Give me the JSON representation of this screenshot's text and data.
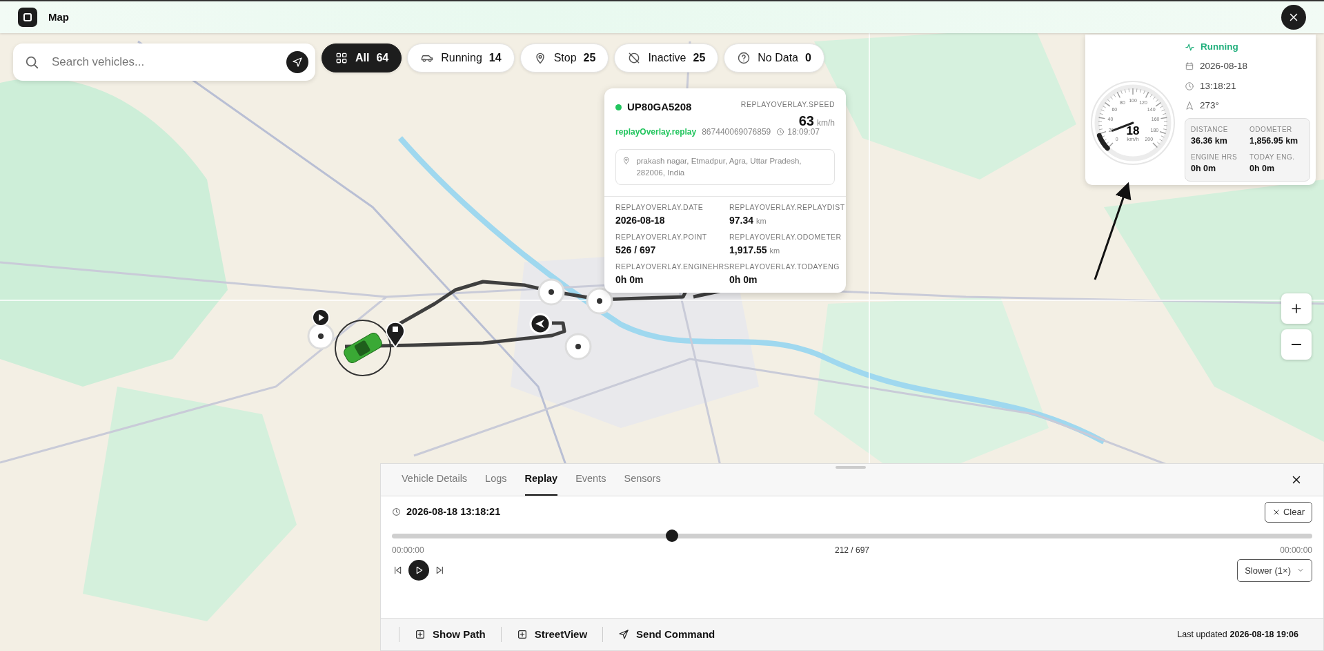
{
  "header": {
    "title": "Map"
  },
  "search": {
    "placeholder": "Search vehicles..."
  },
  "filters": [
    {
      "kind": "grid",
      "label": "All",
      "count": "64",
      "selected": true
    },
    {
      "kind": "car",
      "label": "Running",
      "count": "14",
      "selected": false
    },
    {
      "kind": "pin",
      "label": "Stop",
      "count": "25",
      "selected": false
    },
    {
      "kind": "off",
      "label": "Inactive",
      "count": "25",
      "selected": false
    },
    {
      "kind": "help",
      "label": "No Data",
      "count": "0",
      "selected": false
    }
  ],
  "popup": {
    "plate": "UP80GA5208",
    "online": true,
    "speed_label": "REPLAYOVERLAY.SPEED",
    "speed": "63",
    "speed_unit": "km/h",
    "mode": "replayOverlay.replay",
    "imei": "867440069076859",
    "time": "18:09:07",
    "address": "prakash nagar, Etmadpur, Agra, Uttar Pradesh, 282006, India",
    "fields": [
      {
        "label": "REPLAYOVERLAY.DATE",
        "value": "2026-08-18"
      },
      {
        "label": "REPLAYOVERLAY.REPLAYDIST",
        "value": "97.34",
        "unit": "km"
      },
      {
        "label": "REPLAYOVERLAY.POINT",
        "value": "526 / 697"
      },
      {
        "label": "REPLAYOVERLAY.ODOMETER",
        "value": "1,917.55",
        "unit": "km"
      },
      {
        "label": "REPLAYOVERLAY.ENGINEHRS",
        "value": "0h 0m"
      },
      {
        "label": "REPLAYOVERLAY.TODAYENG",
        "value": "0h 0m"
      }
    ]
  },
  "gauge_card": {
    "scale": [
      "0",
      "20",
      "40",
      "60",
      "80",
      "100",
      "120",
      "140",
      "160",
      "180",
      "200"
    ],
    "level": 0.09,
    "speed": "18",
    "unit": "km/h",
    "status": "Running",
    "date": "2026-08-18",
    "time": "13:18:21",
    "heading": "273°",
    "stats": [
      {
        "label": "DISTANCE",
        "value": "36.36 km"
      },
      {
        "label": "ODOMETER",
        "value": "1,856.95 km"
      },
      {
        "label": "ENGINE HRS",
        "value": "0h 0m"
      },
      {
        "label": "TODAY ENG.",
        "value": "0h 0m"
      }
    ]
  },
  "panel": {
    "tabs": [
      {
        "label": "Vehicle Details",
        "selected": false
      },
      {
        "label": "Logs",
        "selected": false
      },
      {
        "label": "Replay",
        "selected": true
      },
      {
        "label": "Events",
        "selected": false
      },
      {
        "label": "Sensors",
        "selected": false
      }
    ],
    "timestamp": "2026-08-18 13:18:21",
    "clear": "Clear",
    "level": 0.304,
    "start": "00:00:00",
    "position": "212 / 697",
    "end": "00:00:00",
    "speed_option": "Slower (1×)",
    "actions": [
      {
        "kind": "plus",
        "label": "Show Path"
      },
      {
        "kind": "plus",
        "label": "StreetView"
      },
      {
        "kind": "send",
        "label": "Send Command"
      }
    ],
    "updated_label": "Last updated",
    "updated": "2026-08-18 19:06"
  }
}
